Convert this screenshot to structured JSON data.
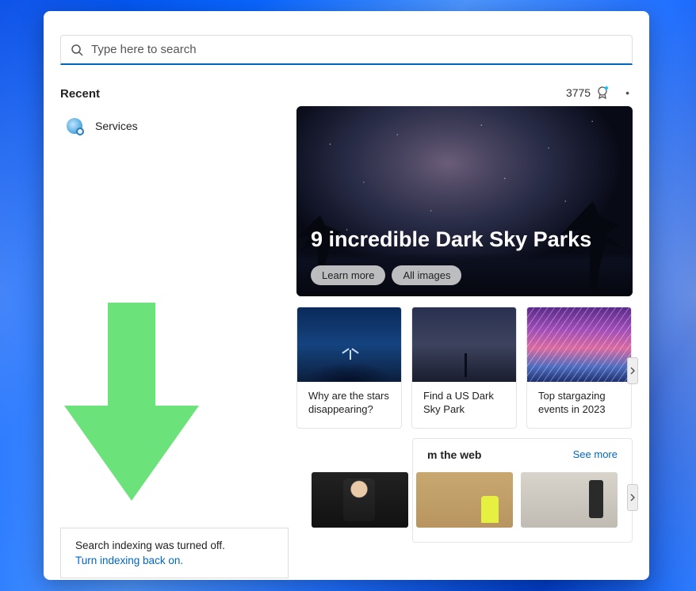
{
  "search": {
    "placeholder": "Type here to search"
  },
  "recent": {
    "header": "Recent",
    "items": [
      {
        "label": "Services"
      }
    ]
  },
  "rewards": {
    "points": "3775"
  },
  "hero": {
    "title": "9 incredible Dark Sky Parks",
    "learn_more": "Learn more",
    "all_images": "All images"
  },
  "cards": [
    {
      "text": "Why are the stars disappearing?"
    },
    {
      "text": "Find a US Dark Sky Park"
    },
    {
      "text": "Top stargazing events in 2023"
    }
  ],
  "web": {
    "title_suffix": "m the web",
    "see_more": "See more"
  },
  "indexing": {
    "message": "Search indexing was turned off.",
    "link": "Turn indexing back on."
  }
}
